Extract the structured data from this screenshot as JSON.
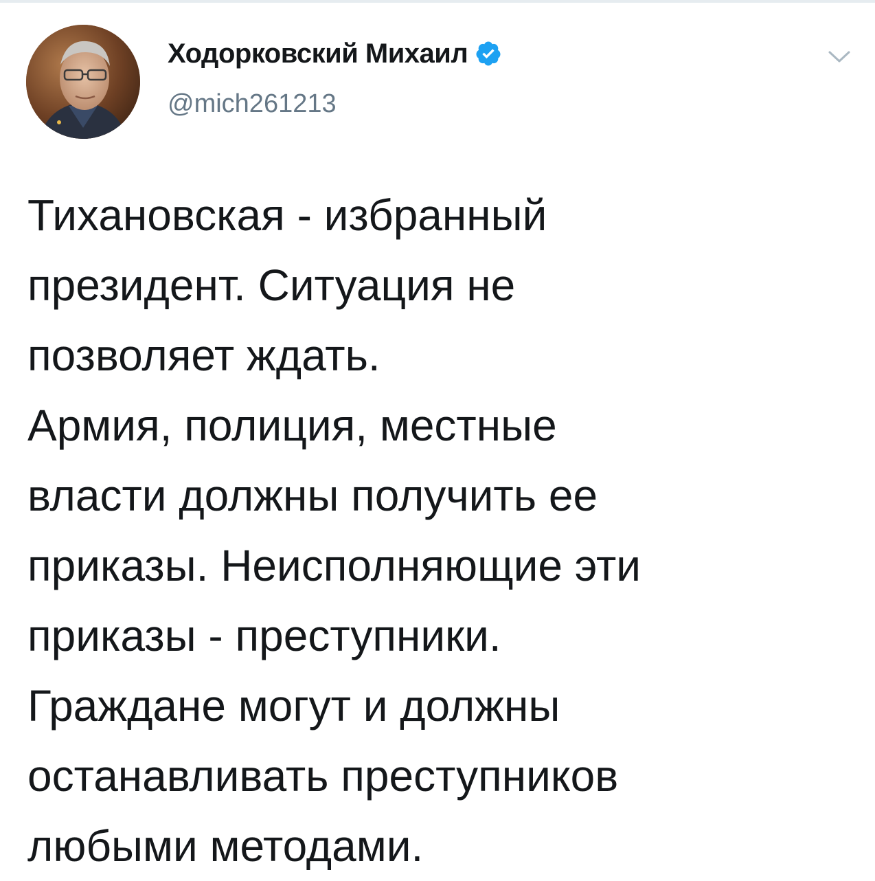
{
  "author": {
    "display_name": "Ходорковский Михаил",
    "handle": "@mich261213",
    "verified": true,
    "avatar_icon": "portrait-photo"
  },
  "icons": {
    "verified": "verified-badge-icon",
    "menu": "chevron-down-icon"
  },
  "tweet": {
    "lines": [
      "Тихановская - избранный",
      "президент. Ситуация не",
      "позволяет ждать.",
      "Армия, полиция, местные",
      "власти должны получить ее",
      "приказы. Неисполняющие эти",
      "приказы - преступники.",
      "Граждане могут и должны",
      "останавливать преступников",
      "любыми методами."
    ]
  },
  "colors": {
    "text": "#14171a",
    "secondary": "#657786",
    "verified": "#1da1f2",
    "divider": "#e6ecf0"
  }
}
